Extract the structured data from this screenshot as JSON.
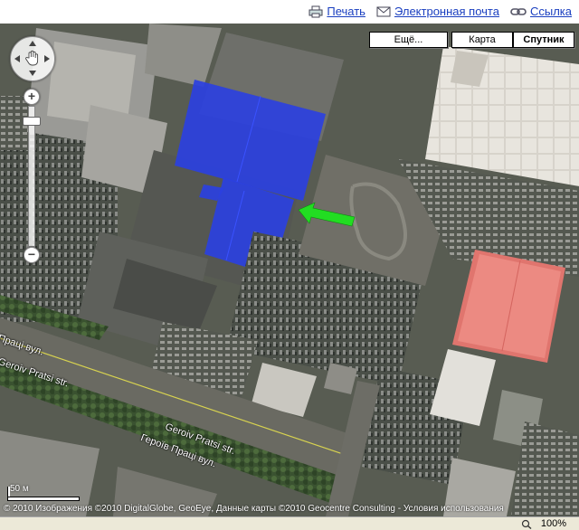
{
  "links": {
    "print": "Печать",
    "email": "Электронная почта",
    "link": "Ссылка"
  },
  "map_types": {
    "more": "Ещё...",
    "map": "Карта",
    "satellite": "Спутник",
    "selected": "satellite"
  },
  "icons": {
    "print": "printer-icon",
    "email": "envelope-icon",
    "link": "chain-link-icon",
    "pan": "hand-icon"
  },
  "zoom_controls": {
    "in": "+",
    "out": "−"
  },
  "roads": [
    {
      "label": "Праці вул."
    },
    {
      "label": "Geroiv Pratsi str."
    },
    {
      "label": "Geroiv Pratsi str."
    },
    {
      "label": "Героїв Праці вул."
    }
  ],
  "scale": {
    "label": "50 м"
  },
  "copyright": "© 2010 Изображения ©2010 DigitalGlobe, GeoEye, Данные карты ©2010 Geocentre Consulting - Условия использования",
  "status": {
    "zoom": "100%"
  },
  "colors": {
    "marker_arrow": "#22dd22",
    "highlight_blue": "#2a3de0",
    "red_roof": "#e8736c"
  }
}
